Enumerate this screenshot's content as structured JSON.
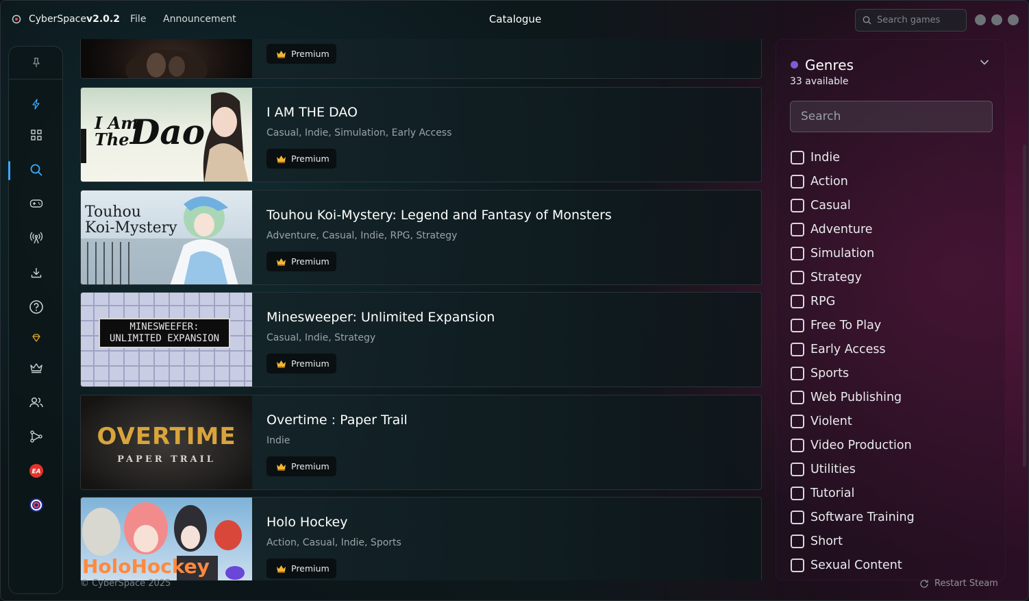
{
  "app": {
    "name": "CyberSpace",
    "version": "v2.0.2",
    "window_title": "Catalogue",
    "menu": [
      {
        "label": "File"
      },
      {
        "label": "Announcement"
      }
    ],
    "search_placeholder": "Search games"
  },
  "sidebar": {
    "items": [
      {
        "icon": "pin-icon"
      },
      {
        "icon": "lightning-icon"
      },
      {
        "icon": "grid-icon"
      },
      {
        "icon": "search-icon",
        "active": true
      },
      {
        "icon": "gamepad-icon"
      },
      {
        "icon": "broadcast-icon"
      },
      {
        "icon": "download-icon"
      },
      {
        "icon": "help-icon"
      },
      {
        "icon": "diamond-icon"
      },
      {
        "icon": "crown-icon"
      },
      {
        "icon": "users-icon"
      },
      {
        "icon": "network-icon"
      },
      {
        "icon": "ea-icon"
      },
      {
        "icon": "ubisoft-icon"
      }
    ]
  },
  "games": [
    {
      "title": "",
      "genres": "",
      "badge": "Premium"
    },
    {
      "title": "I AM THE DAO",
      "genres": "Casual, Indie, Simulation, Early Access",
      "badge": "Premium",
      "thumb_text": [
        "I Am",
        "The",
        "Dao"
      ]
    },
    {
      "title": "Touhou Koi-Mystery: Legend and Fantasy of Monsters",
      "genres": "Adventure, Casual, Indie, RPG, Strategy",
      "badge": "Premium",
      "thumb_text": [
        "Touhou",
        "Koi-Mystery"
      ]
    },
    {
      "title": "Minesweeper: Unlimited Expansion",
      "genres": "Casual, Indie, Strategy",
      "badge": "Premium",
      "thumb_text": [
        "MINESWEEFER:",
        "UNLIMITED EXPANSION"
      ]
    },
    {
      "title": "Overtime : Paper Trail",
      "genres": "Indie",
      "badge": "Premium",
      "thumb_text": [
        "OVERTIME",
        "PAPER TRAIL"
      ]
    },
    {
      "title": "Holo Hockey",
      "genres": "Action, Casual, Indie, Sports",
      "badge": "Premium",
      "thumb_text": [
        "HoloHockey"
      ]
    }
  ],
  "footer": {
    "copyright": "© CyberSpace 2025",
    "restart_label": "Restart Steam"
  },
  "genres_panel": {
    "title": "Genres",
    "count_text": "33 available",
    "search_placeholder": "Search",
    "items": [
      "Indie",
      "Action",
      "Casual",
      "Adventure",
      "Simulation",
      "Strategy",
      "RPG",
      "Free To Play",
      "Early Access",
      "Sports",
      "Web Publishing",
      "Violent",
      "Video Production",
      "Utilities",
      "Tutorial",
      "Software Training",
      "Short",
      "Sexual Content"
    ]
  },
  "colors": {
    "accent": "#3ea8ff",
    "genre_dot": "#7c5cd6",
    "badge_crown": "#f2b632"
  }
}
